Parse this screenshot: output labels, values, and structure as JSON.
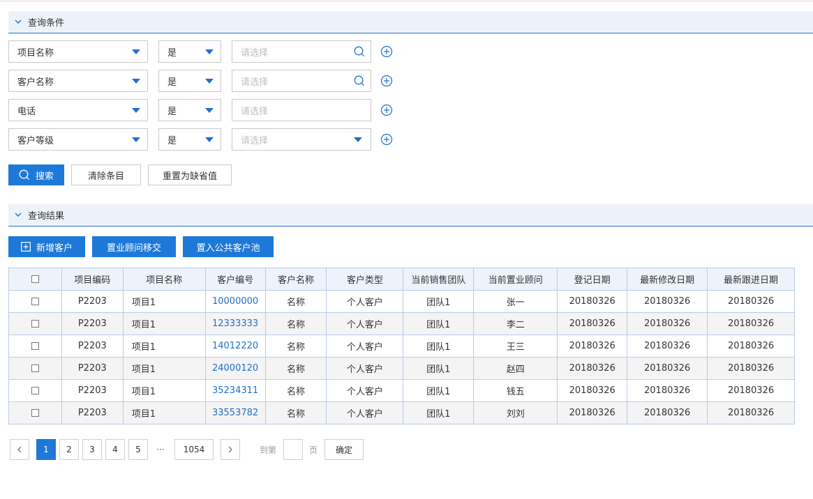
{
  "query_section": {
    "title": "查询条件"
  },
  "filters": [
    {
      "field": "项目名称",
      "op": "是",
      "placeholder": "请选择",
      "control": "search"
    },
    {
      "field": "客户名称",
      "op": "是",
      "placeholder": "请选择",
      "control": "search"
    },
    {
      "field": "电话",
      "op": "是",
      "placeholder": "请选择",
      "control": "text"
    },
    {
      "field": "客户等级",
      "op": "是",
      "placeholder": "请选择",
      "control": "dropdown"
    }
  ],
  "actions": {
    "search": "搜索",
    "clear": "清除条目",
    "reset": "重置为缺省值"
  },
  "result_section": {
    "title": "查询结果"
  },
  "result_actions": {
    "add": "新增客户",
    "transfer": "置业顾问移交",
    "pool": "置入公共客户池"
  },
  "table": {
    "columns": [
      "项目编码",
      "项目名称",
      "客户编号",
      "客户名称",
      "客户类型",
      "当前销售团队",
      "当前置业顾问",
      "登记日期",
      "最新修改日期",
      "最新跟进日期"
    ],
    "rows": [
      [
        "P2203",
        "项目1",
        "10000000",
        "名称",
        "个人客户",
        "团队1",
        "张一",
        "20180326",
        "20180326",
        "20180326"
      ],
      [
        "P2203",
        "项目1",
        "12333333",
        "名称",
        "个人客户",
        "团队1",
        "李二",
        "20180326",
        "20180326",
        "20180326"
      ],
      [
        "P2203",
        "项目1",
        "14012220",
        "名称",
        "个人客户",
        "团队1",
        "王三",
        "20180326",
        "20180326",
        "20180326"
      ],
      [
        "P2203",
        "项目1",
        "24000120",
        "名称",
        "个人客户",
        "团队1",
        "赵四",
        "20180326",
        "20180326",
        "20180326"
      ],
      [
        "P2203",
        "项目1",
        "35234311",
        "名称",
        "个人客户",
        "团队1",
        "钱五",
        "20180326",
        "20180326",
        "20180326"
      ],
      [
        "P2203",
        "项目1",
        "33553782",
        "名称",
        "个人客户",
        "团队1",
        "刘刘",
        "20180326",
        "20180326",
        "20180326"
      ]
    ]
  },
  "pagination": {
    "pages": [
      "1",
      "2",
      "3",
      "4",
      "5"
    ],
    "current": "1",
    "ellipsis": "···",
    "last": "1054",
    "goto_label": "到第",
    "page_unit": "页",
    "confirm": "确定"
  },
  "colors": {
    "primary": "#1e78d7",
    "header_bg": "#edf2fa",
    "accent_line": "#1e6fce"
  }
}
